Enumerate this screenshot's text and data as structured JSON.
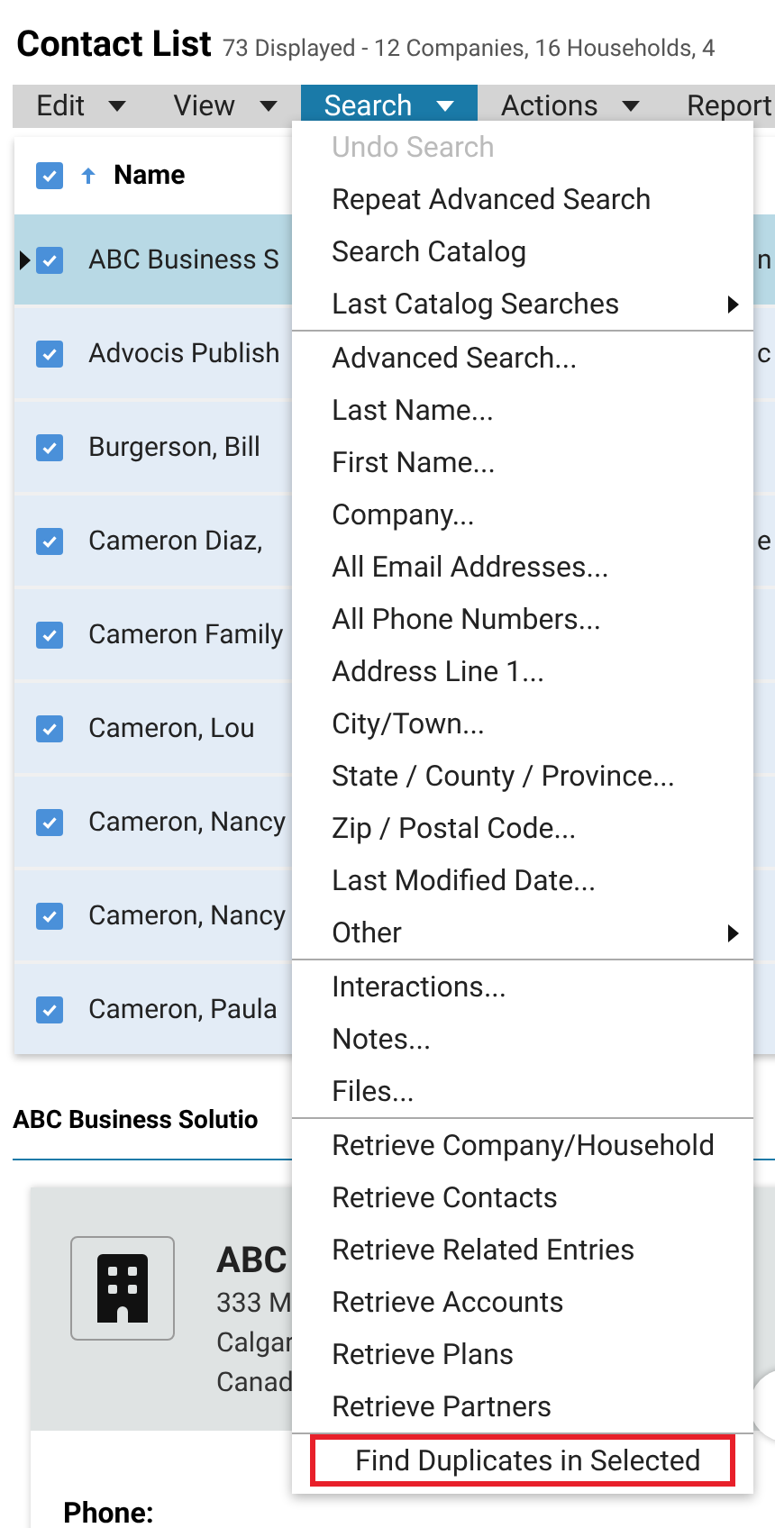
{
  "header": {
    "title": "Contact List",
    "summary": "73 Displayed - 12 Companies, 16 Households, 4"
  },
  "menubar": [
    {
      "label": "Edit",
      "selected": false
    },
    {
      "label": "View",
      "selected": false
    },
    {
      "label": "Search",
      "selected": true
    },
    {
      "label": "Actions",
      "selected": false
    },
    {
      "label": "Report",
      "selected": false
    }
  ],
  "table": {
    "header": {
      "checked": true,
      "sorted": true,
      "label": "Name"
    },
    "rows": [
      {
        "name": "ABC Business S",
        "column_2": "n",
        "checked": true,
        "selected": true,
        "current": true
      },
      {
        "name": "Advocis Publish",
        "column_2": "c",
        "checked": true,
        "selected": false,
        "current": false
      },
      {
        "name": "Burgerson, Bill",
        "checked": true,
        "selected": false,
        "current": false
      },
      {
        "name": "Cameron Diaz,",
        "column_2": "e",
        "checked": true,
        "selected": false,
        "current": false
      },
      {
        "name": "Cameron Family",
        "checked": true,
        "selected": false,
        "current": false
      },
      {
        "name": "Cameron, Lou",
        "checked": true,
        "selected": false,
        "current": false
      },
      {
        "name": "Cameron, Nancy",
        "checked": true,
        "selected": false,
        "current": false
      },
      {
        "name": "Cameron, Nancy",
        "checked": true,
        "selected": false,
        "current": false
      },
      {
        "name": "Cameron, Paula",
        "checked": true,
        "selected": false,
        "current": false
      }
    ]
  },
  "detail": {
    "title": "ABC Business Solutio",
    "name": "ABC",
    "address_lines": [
      "333 M",
      "Calgar",
      "Canad"
    ],
    "phone_label": "Phone:"
  },
  "search_menu": [
    [
      {
        "label": "Undo Search",
        "disabled": true,
        "submenu": false,
        "outlined": false
      },
      {
        "label": "Repeat Advanced Search",
        "disabled": false,
        "submenu": false,
        "outlined": false
      },
      {
        "label": "Search Catalog",
        "disabled": false,
        "submenu": false,
        "outlined": false
      },
      {
        "label": "Last Catalog Searches",
        "disabled": false,
        "submenu": true,
        "outlined": false
      }
    ],
    [
      {
        "label": "Advanced Search...",
        "disabled": false,
        "submenu": false,
        "outlined": false
      },
      {
        "label": "Last Name...",
        "disabled": false,
        "submenu": false,
        "outlined": false
      },
      {
        "label": "First Name...",
        "disabled": false,
        "submenu": false,
        "outlined": false
      },
      {
        "label": "Company...",
        "disabled": false,
        "submenu": false,
        "outlined": false
      },
      {
        "label": "All Email Addresses...",
        "disabled": false,
        "submenu": false,
        "outlined": false
      },
      {
        "label": "All Phone Numbers...",
        "disabled": false,
        "submenu": false,
        "outlined": false
      },
      {
        "label": "Address Line 1...",
        "disabled": false,
        "submenu": false,
        "outlined": false
      },
      {
        "label": "City/Town...",
        "disabled": false,
        "submenu": false,
        "outlined": false
      },
      {
        "label": "State / County / Province...",
        "disabled": false,
        "submenu": false,
        "outlined": false
      },
      {
        "label": "Zip / Postal Code...",
        "disabled": false,
        "submenu": false,
        "outlined": false
      },
      {
        "label": "Last Modified Date...",
        "disabled": false,
        "submenu": false,
        "outlined": false
      },
      {
        "label": "Other",
        "disabled": false,
        "submenu": true,
        "outlined": false
      }
    ],
    [
      {
        "label": "Interactions...",
        "disabled": false,
        "submenu": false,
        "outlined": false
      },
      {
        "label": "Notes...",
        "disabled": false,
        "submenu": false,
        "outlined": false
      },
      {
        "label": "Files...",
        "disabled": false,
        "submenu": false,
        "outlined": false
      }
    ],
    [
      {
        "label": "Retrieve Company/Household",
        "disabled": false,
        "submenu": false,
        "outlined": false
      },
      {
        "label": "Retrieve Contacts",
        "disabled": false,
        "submenu": false,
        "outlined": false
      },
      {
        "label": "Retrieve Related Entries",
        "disabled": false,
        "submenu": false,
        "outlined": false
      },
      {
        "label": "Retrieve Accounts",
        "disabled": false,
        "submenu": false,
        "outlined": false
      },
      {
        "label": "Retrieve Plans",
        "disabled": false,
        "submenu": false,
        "outlined": false
      },
      {
        "label": "Retrieve Partners",
        "disabled": false,
        "submenu": false,
        "outlined": false
      }
    ],
    [
      {
        "label": "Find Duplicates in Selected",
        "disabled": false,
        "submenu": false,
        "outlined": true
      }
    ]
  ]
}
